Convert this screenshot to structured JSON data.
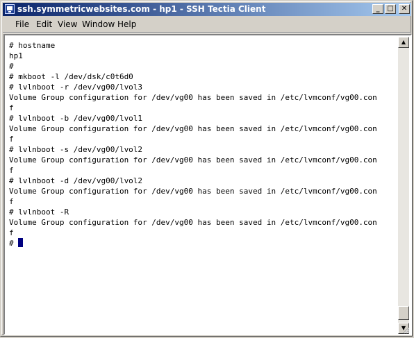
{
  "window": {
    "title": "ssh.symmetricwebsites.com - hp1 - SSH Tectia Client"
  },
  "caption": {
    "minimize": "_",
    "maximize": "□",
    "close": "✕"
  },
  "menu": [
    "File",
    "Edit",
    "View",
    "Window",
    "Help"
  ],
  "terminal": {
    "lines": [
      "# hostname",
      "hp1",
      "#",
      "# mkboot -l /dev/dsk/c0t6d0",
      "# lvlnboot -r /dev/vg00/lvol3",
      "Volume Group configuration for /dev/vg00 has been saved in /etc/lvmconf/vg00.con",
      "f",
      "# lvlnboot -b /dev/vg00/lvol1",
      "Volume Group configuration for /dev/vg00 has been saved in /etc/lvmconf/vg00.con",
      "f",
      "# lvlnboot -s /dev/vg00/lvol2",
      "Volume Group configuration for /dev/vg00 has been saved in /etc/lvmconf/vg00.con",
      "f",
      "# lvlnboot -d /dev/vg00/lvol2",
      "Volume Group configuration for /dev/vg00 has been saved in /etc/lvmconf/vg00.con",
      "f",
      "# lvlnboot -R",
      "Volume Group configuration for /dev/vg00 has been saved in /etc/lvmconf/vg00.con",
      "f",
      "#"
    ]
  },
  "scrollbar": {
    "up": "▲",
    "down": "▼"
  },
  "colors": {
    "titlebar_start": "#0a246a",
    "titlebar_end": "#a6caf0",
    "cursor": "#000080"
  }
}
